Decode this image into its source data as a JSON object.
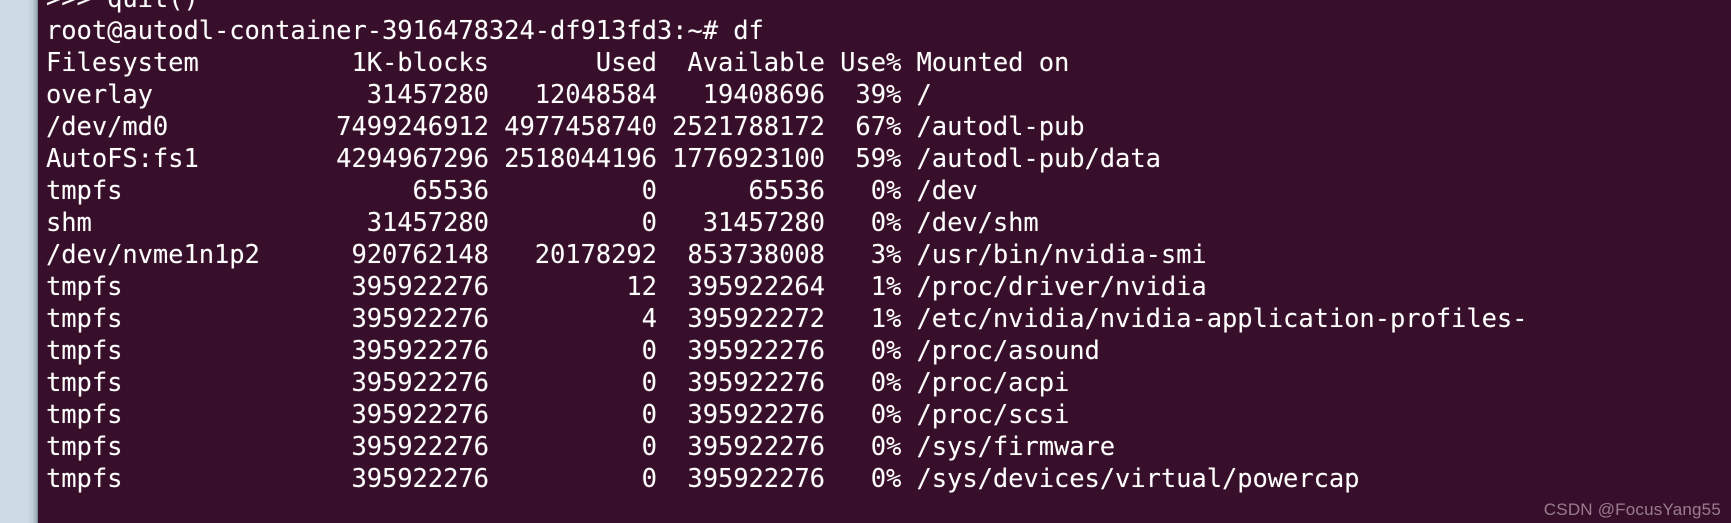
{
  "terminal": {
    "background_color": "#380f2a",
    "foreground_color": "#ffffff",
    "gutter_color": "#ccdbe4",
    "scrollback_top_line": ">>> quit()",
    "prompt": {
      "user": "root",
      "host": "autodl-container-3916478324-df913fd3",
      "path": "~",
      "symbol": "#",
      "full": "root@autodl-container-3916478324-df913fd3:~# ",
      "command": "df"
    },
    "header": "Filesystem          1K-blocks       Used  Available Use% Mounted on",
    "columns": [
      "Filesystem",
      "1K-blocks",
      "Used",
      "Available",
      "Use%",
      "Mounted on"
    ],
    "rows": [
      {
        "line": "overlay              31457280   12048584   19408696  39% /",
        "filesystem": "overlay",
        "blocks": "31457280",
        "used": "12048584",
        "available": "19408696",
        "use_pct": "39%",
        "mounted_on": "/"
      },
      {
        "line": "/dev/md0           7499246912 4977458740 2521788172  67% /autodl-pub",
        "filesystem": "/dev/md0",
        "blocks": "7499246912",
        "used": "4977458740",
        "available": "2521788172",
        "use_pct": "67%",
        "mounted_on": "/autodl-pub"
      },
      {
        "line": "AutoFS:fs1         4294967296 2518044196 1776923100  59% /autodl-pub/data",
        "filesystem": "AutoFS:fs1",
        "blocks": "4294967296",
        "used": "2518044196",
        "available": "1776923100",
        "use_pct": "59%",
        "mounted_on": "/autodl-pub/data"
      },
      {
        "line": "tmpfs                   65536          0      65536   0% /dev",
        "filesystem": "tmpfs",
        "blocks": "65536",
        "used": "0",
        "available": "65536",
        "use_pct": "0%",
        "mounted_on": "/dev"
      },
      {
        "line": "shm                  31457280          0   31457280   0% /dev/shm",
        "filesystem": "shm",
        "blocks": "31457280",
        "used": "0",
        "available": "31457280",
        "use_pct": "0%",
        "mounted_on": "/dev/shm"
      },
      {
        "line": "/dev/nvme1n1p2      920762148   20178292  853738008   3% /usr/bin/nvidia-smi",
        "filesystem": "/dev/nvme1n1p2",
        "blocks": "920762148",
        "used": "20178292",
        "available": "853738008",
        "use_pct": "3%",
        "mounted_on": "/usr/bin/nvidia-smi"
      },
      {
        "line": "tmpfs               395922276         12  395922264   1% /proc/driver/nvidia",
        "filesystem": "tmpfs",
        "blocks": "395922276",
        "used": "12",
        "available": "395922264",
        "use_pct": "1%",
        "mounted_on": "/proc/driver/nvidia"
      },
      {
        "line": "tmpfs               395922276          4  395922272   1% /etc/nvidia/nvidia-application-profiles-",
        "filesystem": "tmpfs",
        "blocks": "395922276",
        "used": "4",
        "available": "395922272",
        "use_pct": "1%",
        "mounted_on": "/etc/nvidia/nvidia-application-profiles-"
      },
      {
        "line": "tmpfs               395922276          0  395922276   0% /proc/asound",
        "filesystem": "tmpfs",
        "blocks": "395922276",
        "used": "0",
        "available": "395922276",
        "use_pct": "0%",
        "mounted_on": "/proc/asound"
      },
      {
        "line": "tmpfs               395922276          0  395922276   0% /proc/acpi",
        "filesystem": "tmpfs",
        "blocks": "395922276",
        "used": "0",
        "available": "395922276",
        "use_pct": "0%",
        "mounted_on": "/proc/acpi"
      },
      {
        "line": "tmpfs               395922276          0  395922276   0% /proc/scsi",
        "filesystem": "tmpfs",
        "blocks": "395922276",
        "used": "0",
        "available": "395922276",
        "use_pct": "0%",
        "mounted_on": "/proc/scsi"
      },
      {
        "line": "tmpfs               395922276          0  395922276   0% /sys/firmware",
        "filesystem": "tmpfs",
        "blocks": "395922276",
        "used": "0",
        "available": "395922276",
        "use_pct": "0%",
        "mounted_on": "/sys/firmware"
      },
      {
        "line": "tmpfs               395922276          0  395922276   0% /sys/devices/virtual/powercap",
        "filesystem": "tmpfs",
        "blocks": "395922276",
        "used": "0",
        "available": "395922276",
        "use_pct": "0%",
        "mounted_on": "/sys/devices/virtual/powercap"
      }
    ]
  },
  "watermark": {
    "text": "CSDN @FocusYang55"
  }
}
